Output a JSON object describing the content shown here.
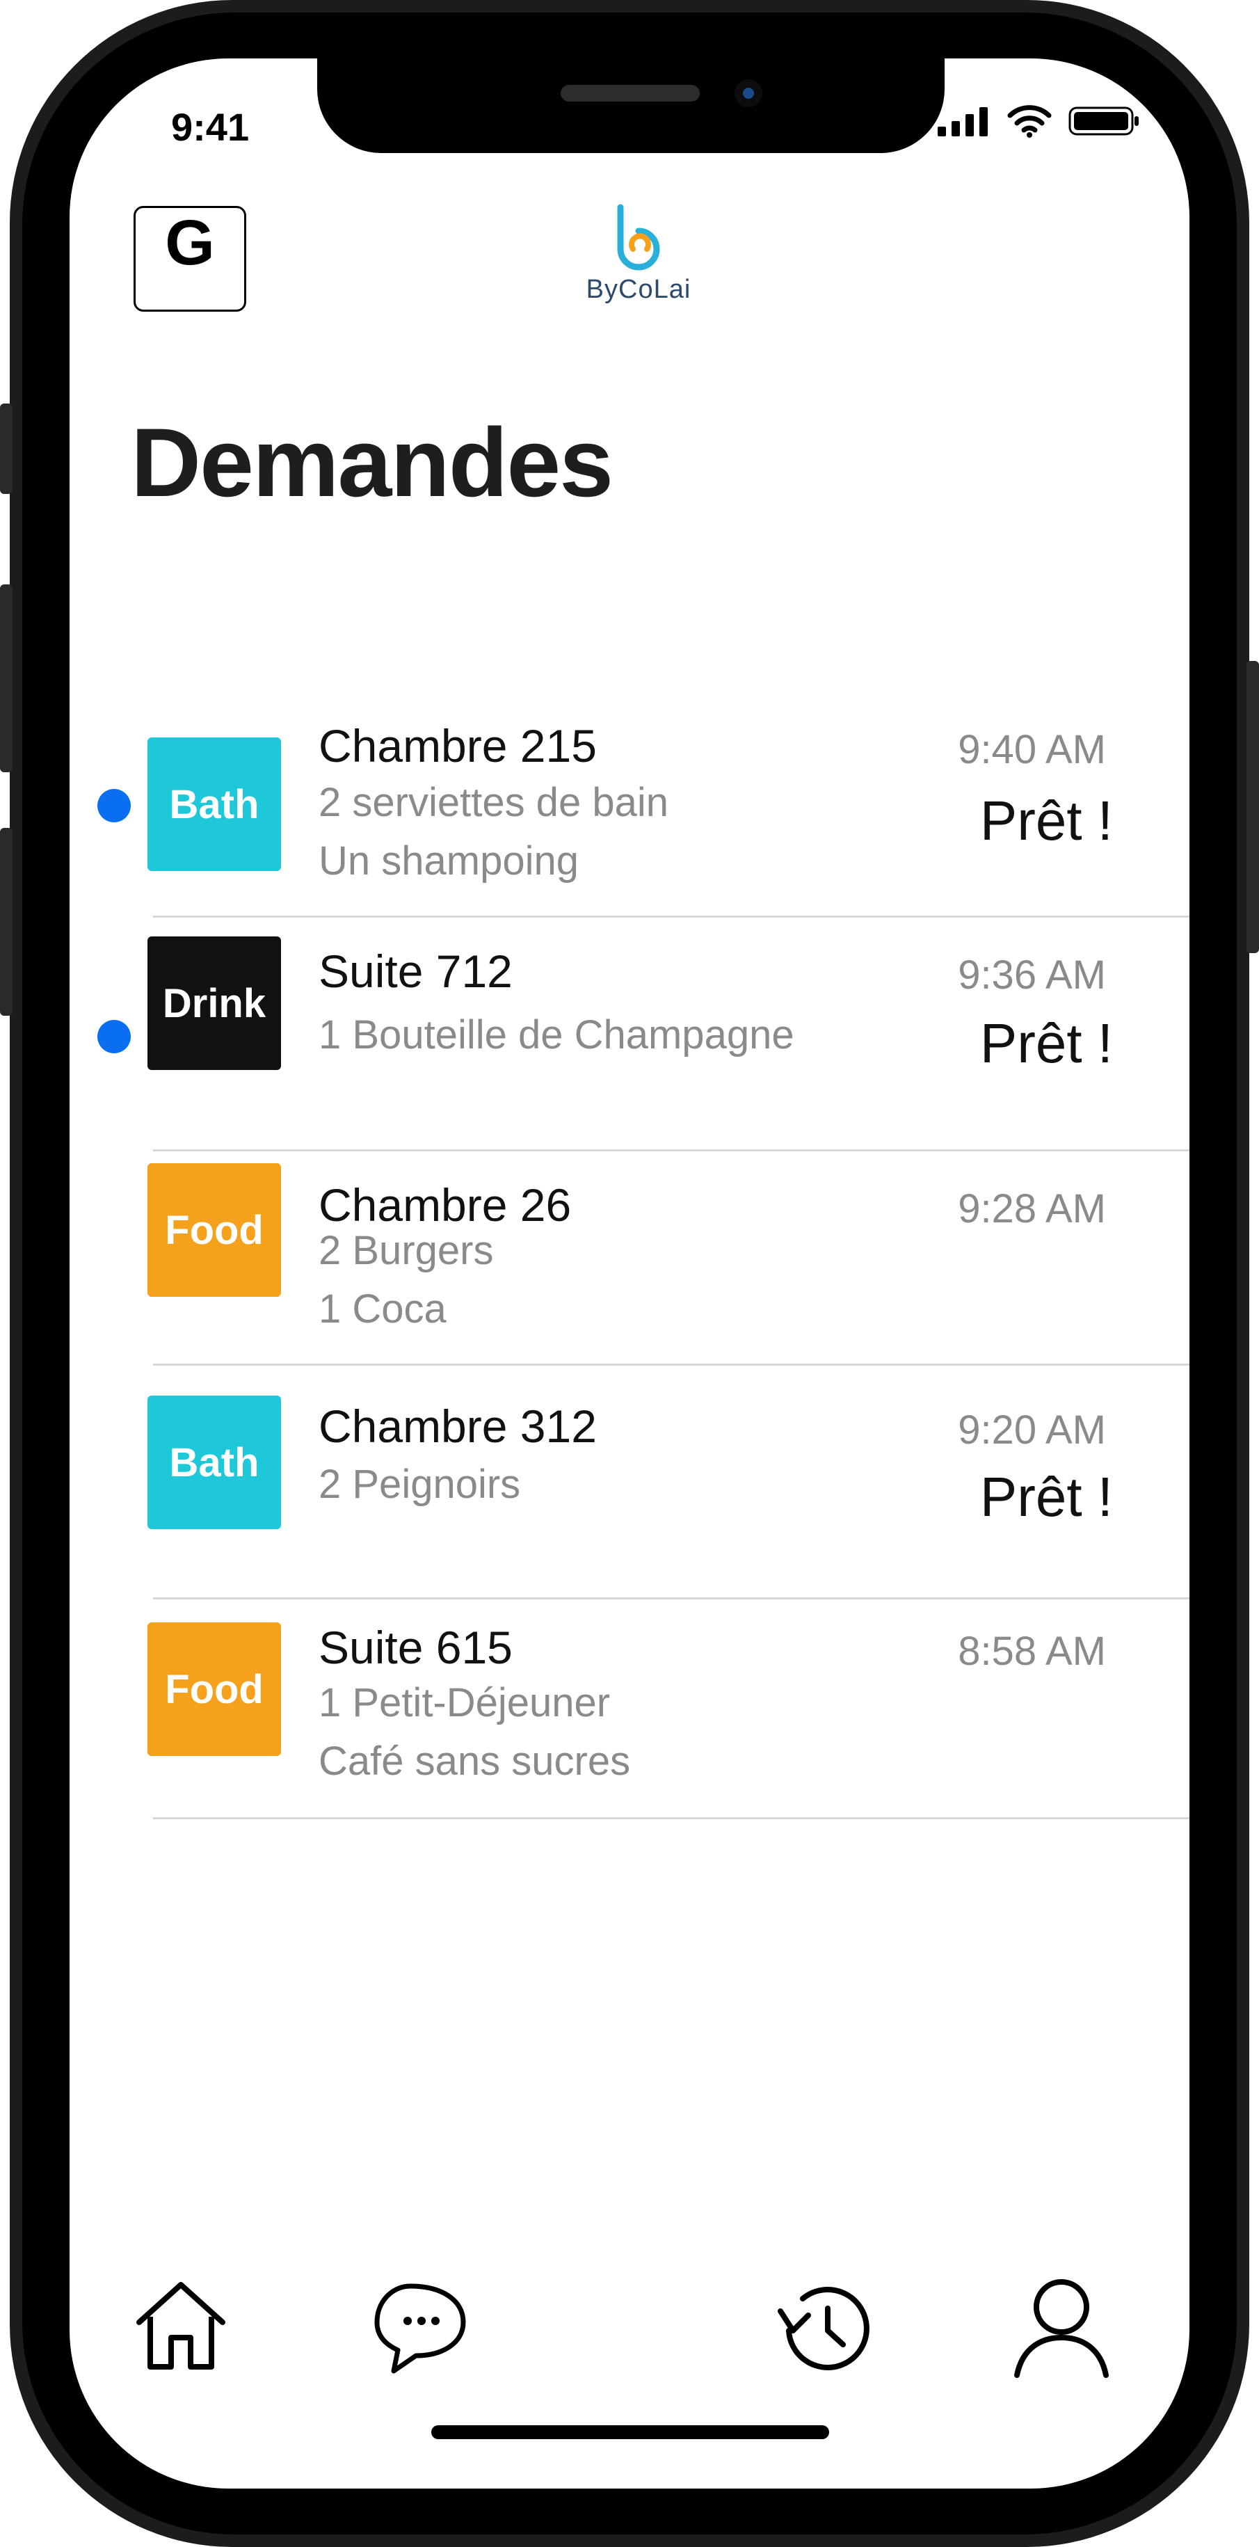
{
  "status_bar": {
    "time": "9:41"
  },
  "header": {
    "profile_initial": "G",
    "logo_text": "ByCoLai"
  },
  "page": {
    "title": "Demandes"
  },
  "requests": [
    {
      "category": "Bath",
      "category_color": "#1ec8d8",
      "room": "Chambre 215",
      "details": [
        "2 serviettes de bain",
        "Un shampoing"
      ],
      "time": "9:40 AM",
      "status": "Prêt !",
      "unread": true
    },
    {
      "category": "Drink",
      "category_color": "#111111",
      "room": "Suite 712",
      "details": [
        "1 Bouteille de Champagne"
      ],
      "time": "9:36 AM",
      "status": "Prêt !",
      "unread": true
    },
    {
      "category": "Food",
      "category_color": "#f5a11c",
      "room": "Chambre 26",
      "details": [
        "2 Burgers",
        "1 Coca"
      ],
      "time": "9:28 AM",
      "status": "",
      "unread": false
    },
    {
      "category": "Bath",
      "category_color": "#1ec8d8",
      "room": "Chambre 312",
      "details": [
        "2 Peignoirs"
      ],
      "time": "9:20 AM",
      "status": "Prêt !",
      "unread": false
    },
    {
      "category": "Food",
      "category_color": "#f5a11c",
      "room": "Suite 615",
      "details": [
        "1 Petit-Déjeuner",
        "Café sans sucres"
      ],
      "time": "8:58 AM",
      "status": "",
      "unread": false
    }
  ],
  "tab_bar": {
    "icons": [
      "home-icon",
      "chat-icon",
      "history-icon",
      "profile-icon"
    ]
  }
}
